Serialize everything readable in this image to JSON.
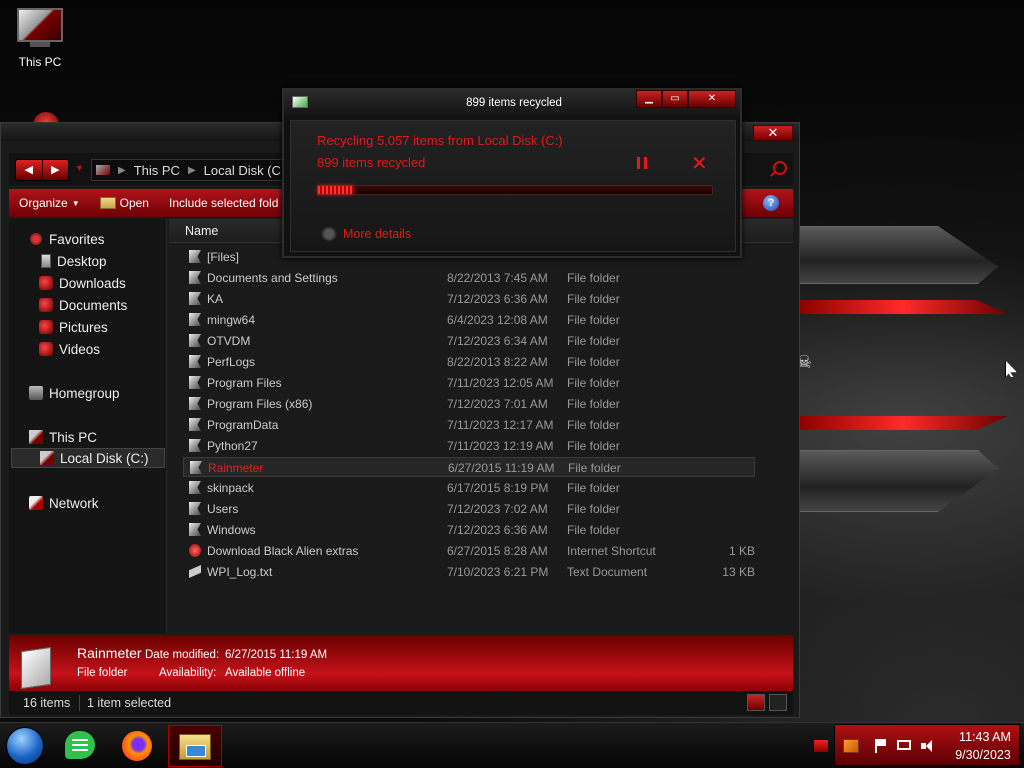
{
  "desktop": {
    "icons": [
      {
        "label": "This PC"
      }
    ]
  },
  "explorer": {
    "address": {
      "crumbs": [
        "This PC",
        "Local Disk (C:)"
      ]
    },
    "toolbar": {
      "organize": "Organize",
      "open": "Open",
      "include": "Include selected fold"
    },
    "nav": {
      "favorites": "Favorites",
      "desktop": "Desktop",
      "downloads": "Downloads",
      "documents": "Documents",
      "pictures": "Pictures",
      "videos": "Videos",
      "homegroup": "Homegroup",
      "this_pc": "This PC",
      "local_disk": "Local Disk (C:)",
      "network": "Network"
    },
    "columns": {
      "name": "Name"
    },
    "files": [
      {
        "name": "[Files]",
        "date": "",
        "type": "",
        "size": ""
      },
      {
        "name": "Documents and Settings",
        "date": "8/22/2013 7:45 AM",
        "type": "File folder",
        "size": ""
      },
      {
        "name": "KA",
        "date": "7/12/2023 6:36 AM",
        "type": "File folder",
        "size": ""
      },
      {
        "name": "mingw64",
        "date": "6/4/2023 12:08 AM",
        "type": "File folder",
        "size": ""
      },
      {
        "name": "OTVDM",
        "date": "7/12/2023 6:34 AM",
        "type": "File folder",
        "size": ""
      },
      {
        "name": "PerfLogs",
        "date": "8/22/2013 8:22 AM",
        "type": "File folder",
        "size": ""
      },
      {
        "name": "Program Files",
        "date": "7/11/2023 12:05 AM",
        "type": "File folder",
        "size": ""
      },
      {
        "name": "Program Files (x86)",
        "date": "7/12/2023 7:01 AM",
        "type": "File folder",
        "size": ""
      },
      {
        "name": "ProgramData",
        "date": "7/11/2023 12:17 AM",
        "type": "File folder",
        "size": ""
      },
      {
        "name": "Python27",
        "date": "7/11/2023 12:19 AM",
        "type": "File folder",
        "size": ""
      },
      {
        "name": "Rainmeter",
        "date": "6/27/2015 11:19 AM",
        "type": "File folder",
        "size": ""
      },
      {
        "name": "skinpack",
        "date": "6/17/2015 8:19 PM",
        "type": "File folder",
        "size": ""
      },
      {
        "name": "Users",
        "date": "7/12/2023 7:02 AM",
        "type": "File folder",
        "size": ""
      },
      {
        "name": "Windows",
        "date": "7/12/2023 6:36 AM",
        "type": "File folder",
        "size": ""
      },
      {
        "name": "Download Black Alien extras",
        "date": "6/27/2015 8:28 AM",
        "type": "Internet Shortcut",
        "size": "1 KB"
      },
      {
        "name": "WPI_Log.txt",
        "date": "7/10/2023 6:21 PM",
        "type": "Text Document",
        "size": "13 KB"
      }
    ],
    "details": {
      "name": "Rainmeter",
      "type": "File folder",
      "date_label": "Date modified:",
      "date_value": "6/27/2015 11:19 AM",
      "avail_label": "Availability:",
      "avail_value": "Available offline"
    },
    "status": {
      "count": "16 items",
      "selected": "1 item selected"
    }
  },
  "dialog": {
    "title": "899 items recycled",
    "line1": "Recycling 5,057 items from Local Disk (C:)",
    "line2": "899 items recycled",
    "progress_fraction": 0.09,
    "more_details": "More details"
  },
  "taskbar": {
    "time": "11:43 AM",
    "date": "9/30/2023"
  }
}
